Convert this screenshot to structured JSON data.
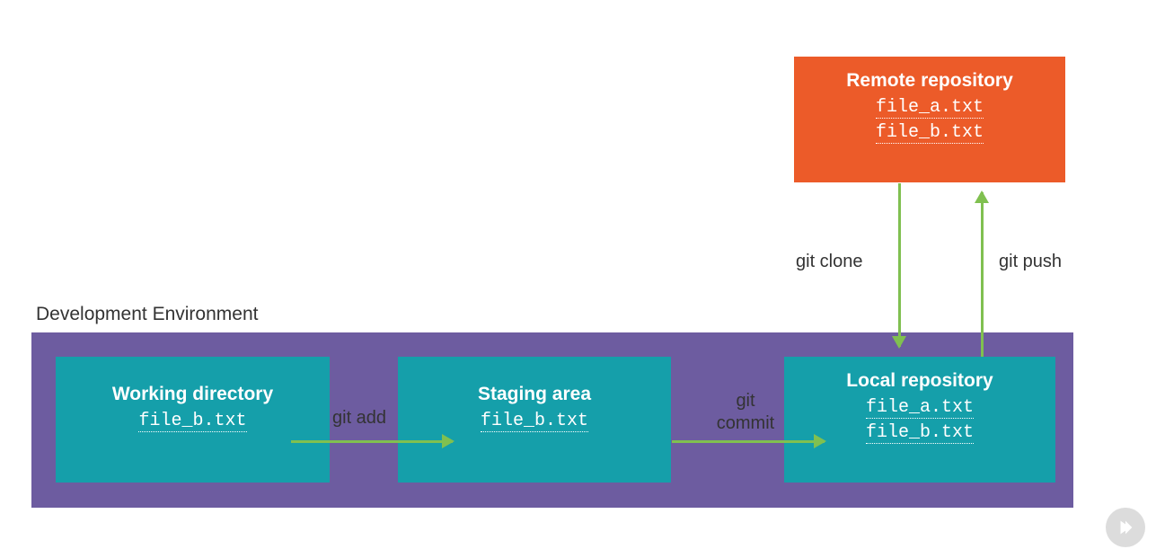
{
  "labels": {
    "dev_env": "Development Environment"
  },
  "boxes": {
    "remote": {
      "title": "Remote repository",
      "files": [
        "file_a.txt",
        "file_b.txt"
      ]
    },
    "working": {
      "title": "Working directory",
      "files": [
        "file_b.txt"
      ]
    },
    "staging": {
      "title": "Staging area",
      "files": [
        "file_b.txt"
      ]
    },
    "local": {
      "title": "Local repository",
      "files": [
        "file_a.txt",
        "file_b.txt"
      ]
    }
  },
  "arrows": {
    "add": "git add",
    "commit_l1": "git",
    "commit_l2": "commit",
    "clone": "git clone",
    "push": "git push"
  },
  "colors": {
    "teal": "#159faa",
    "orange": "#ec5b29",
    "purple": "#6d5ca0",
    "arrow": "#80c050"
  }
}
